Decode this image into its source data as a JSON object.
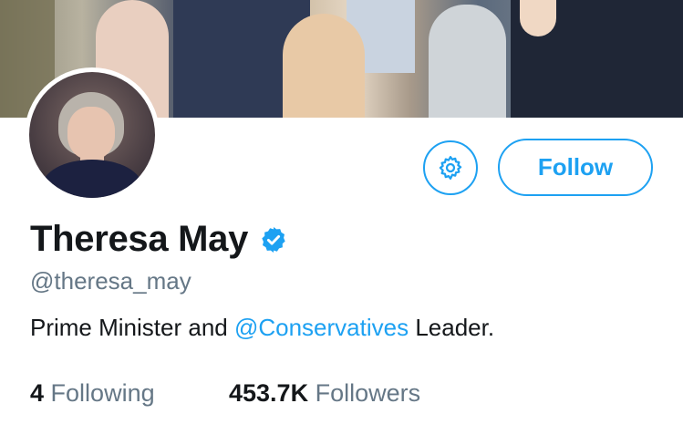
{
  "profile": {
    "display_name": "Theresa May",
    "handle": "@theresa_may",
    "verified_icon": "verified-badge-icon",
    "bio": {
      "prefix": "Prime Minister and ",
      "mention": "@Conservatives",
      "suffix": " Leader."
    }
  },
  "actions": {
    "settings_icon": "gear-icon",
    "follow_label": "Follow"
  },
  "stats": {
    "following_count": "4",
    "following_label": "Following",
    "followers_count": "453.7K",
    "followers_label": "Followers"
  },
  "colors": {
    "accent": "#1da1f2",
    "text": "#14171a",
    "muted": "#657786"
  }
}
